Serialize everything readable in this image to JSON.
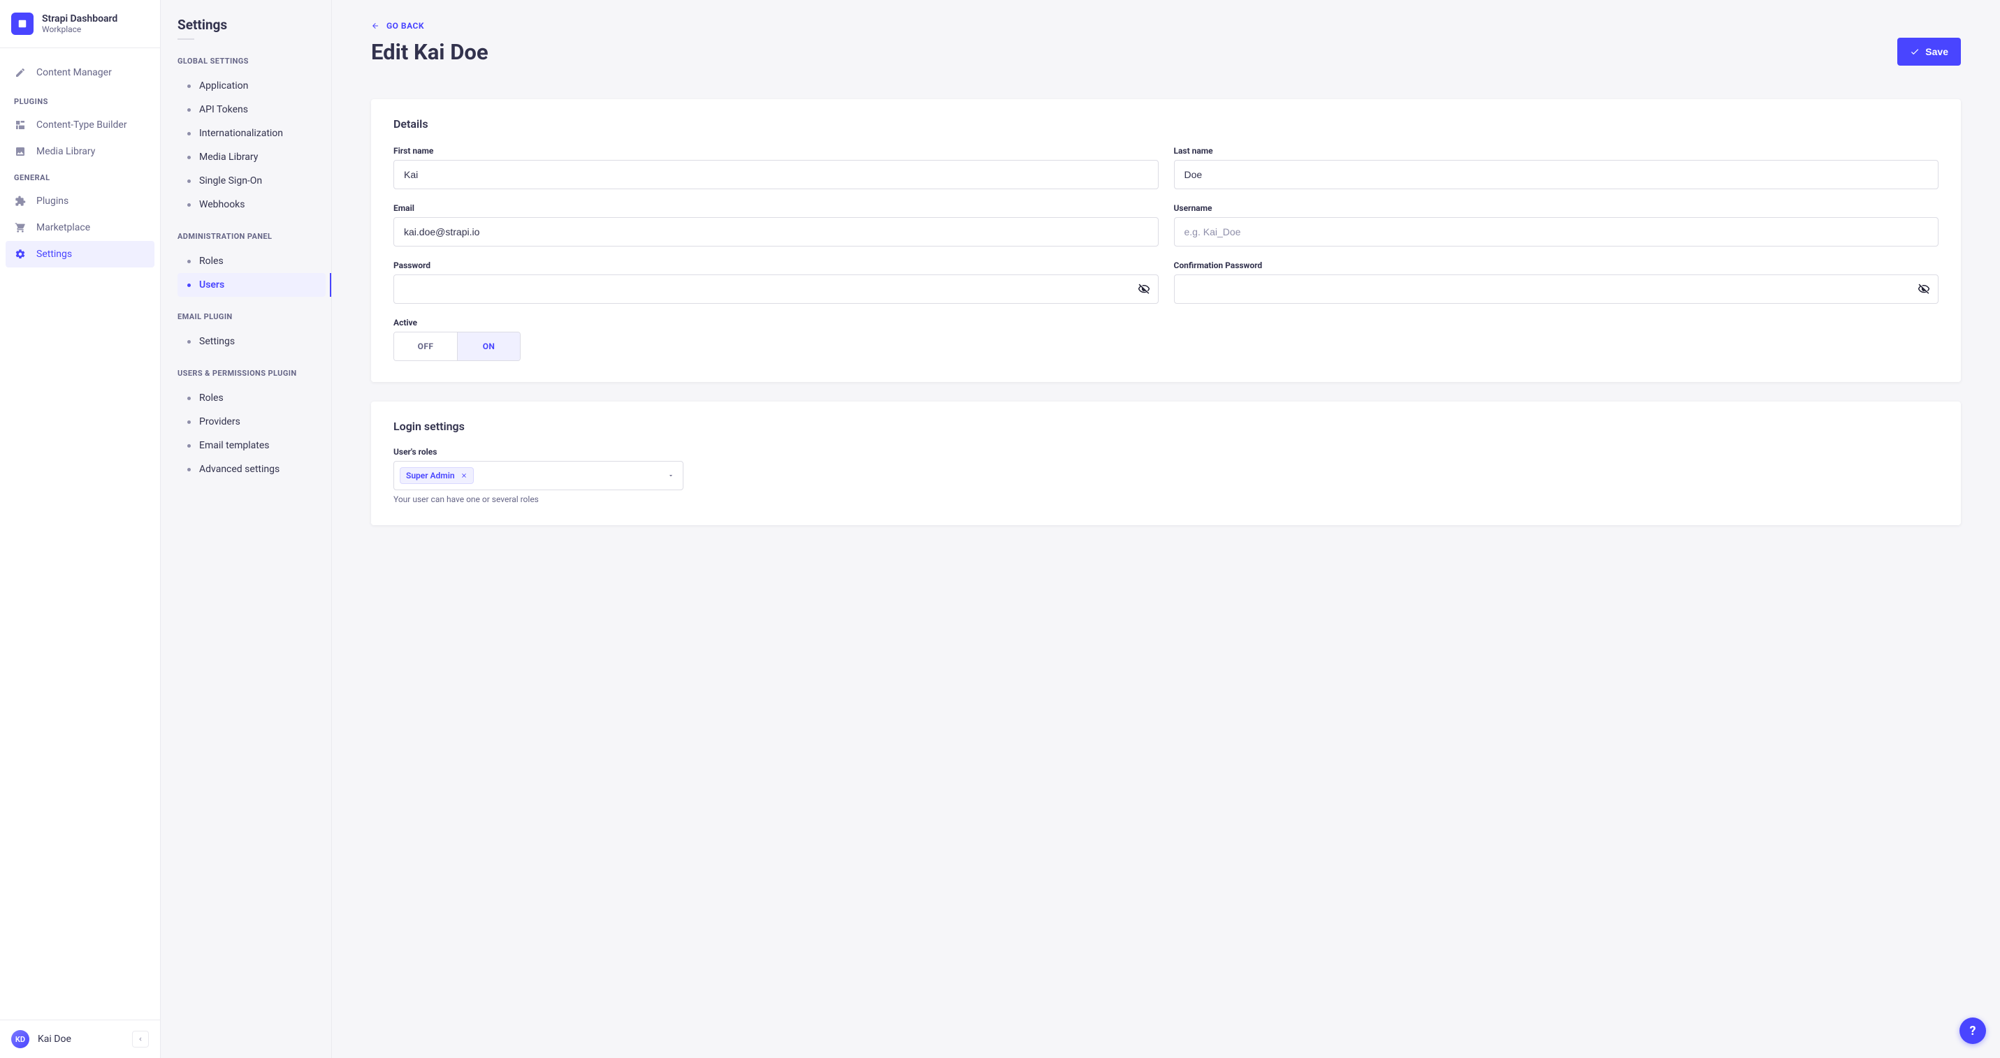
{
  "brand": {
    "title": "Strapi Dashboard",
    "subtitle": "Workplace"
  },
  "main_nav": {
    "content_manager": "Content Manager",
    "plugins_label": "PLUGINS",
    "content_type_builder": "Content-Type Builder",
    "media_library": "Media Library",
    "general_label": "GENERAL",
    "plugins": "Plugins",
    "marketplace": "Marketplace",
    "settings": "Settings"
  },
  "user_footer": {
    "initials": "KD",
    "name": "Kai Doe"
  },
  "sub_sidebar": {
    "title": "Settings",
    "global_settings_label": "GLOBAL SETTINGS",
    "global_items": [
      "Application",
      "API Tokens",
      "Internationalization",
      "Media Library",
      "Single Sign-On",
      "Webhooks"
    ],
    "admin_panel_label": "ADMINISTRATION PANEL",
    "admin_items": [
      "Roles",
      "Users"
    ],
    "email_plugin_label": "EMAIL PLUGIN",
    "email_items": [
      "Settings"
    ],
    "users_permissions_label": "USERS & PERMISSIONS PLUGIN",
    "up_items": [
      "Roles",
      "Providers",
      "Email templates",
      "Advanced settings"
    ]
  },
  "page": {
    "go_back": "GO BACK",
    "title": "Edit Kai Doe",
    "save": "Save"
  },
  "details": {
    "heading": "Details",
    "first_name_label": "First name",
    "first_name": "Kai",
    "last_name_label": "Last name",
    "last_name": "Doe",
    "email_label": "Email",
    "email": "kai.doe@strapi.io",
    "username_label": "Username",
    "username_placeholder": "e.g. Kai_Doe",
    "username": "",
    "password_label": "Password",
    "confirm_password_label": "Confirmation Password",
    "active_label": "Active",
    "off": "OFF",
    "on": "ON"
  },
  "login_settings": {
    "heading": "Login settings",
    "roles_label": "User's roles",
    "role_tag": "Super Admin",
    "help": "Your user can have one or several roles"
  },
  "help_fab": "?"
}
